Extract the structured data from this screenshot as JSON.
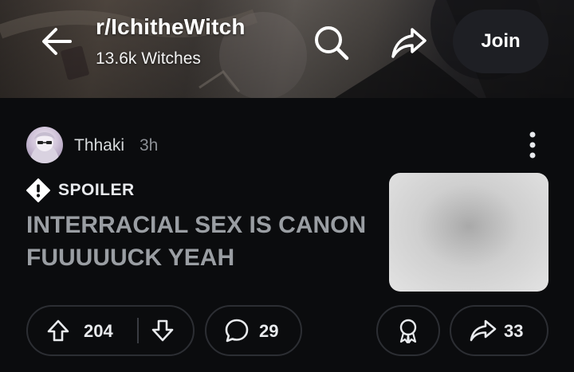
{
  "header": {
    "subreddit": "r/IchitheWitch",
    "members": "13.6k Witches",
    "join_label": "Join",
    "icons": {
      "back": "back-arrow-icon",
      "search": "search-icon",
      "share": "share-icon"
    }
  },
  "post": {
    "author": "Thhaki",
    "time": "3h",
    "flair": "SPOILER",
    "title": "INTERRACIAL SEX IS CANON FUUUUUCK YEAH",
    "score": "204",
    "comments": "29",
    "shares": "33",
    "icons": {
      "more": "more-vertical-icon",
      "spoiler": "spoiler-warning-icon",
      "upvote": "upvote-arrow-icon",
      "downvote": "downvote-arrow-icon",
      "comment": "comment-bubble-icon",
      "award": "award-ribbon-icon",
      "share": "share-arrow-icon"
    }
  },
  "colors": {
    "background": "#0b0c0e",
    "pill_border": "#2c2e33",
    "title_text": "#9a9ea3",
    "join_bg": "#1e1f24"
  }
}
